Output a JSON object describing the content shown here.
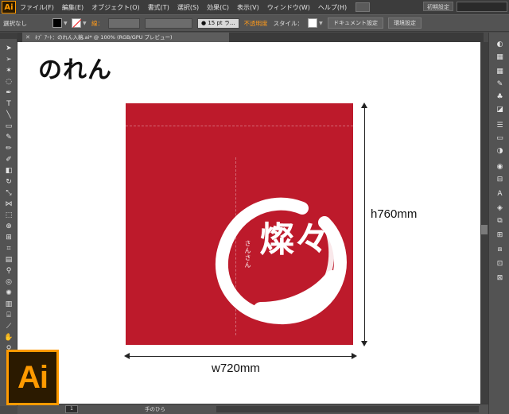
{
  "app": {
    "logo_text": "Ai",
    "accent_color": "#ff9a00",
    "workspace": "初期設定"
  },
  "menu": {
    "items": [
      "ファイル(F)",
      "編集(E)",
      "オブジェクト(O)",
      "書式(T)",
      "選択(S)",
      "効果(C)",
      "表示(V)",
      "ウィンドウ(W)",
      "ヘルプ(H)"
    ]
  },
  "control": {
    "selection_label": "選択なし",
    "stroke_label": "線：",
    "brush_label": "● 15 pt ラ...",
    "opacity_label": "不透明度",
    "style_label": "スタイル：",
    "document_setup": "ドキュメント設定",
    "preferences": "環境設定"
  },
  "tab": {
    "title": "ﾈﾌﾞ ｱｰﾄ：のれん入稿.ai* @ 100% (RGB/GPU プレビュー)"
  },
  "artwork": {
    "heading": "のれん",
    "noren_color": "#bd1a2b",
    "kanji": "燦々",
    "kana": "さんさん",
    "height_label": "h760mm",
    "width_label": "w720mm"
  },
  "status": {
    "zoom": "1",
    "tool_text": "手のひら"
  }
}
